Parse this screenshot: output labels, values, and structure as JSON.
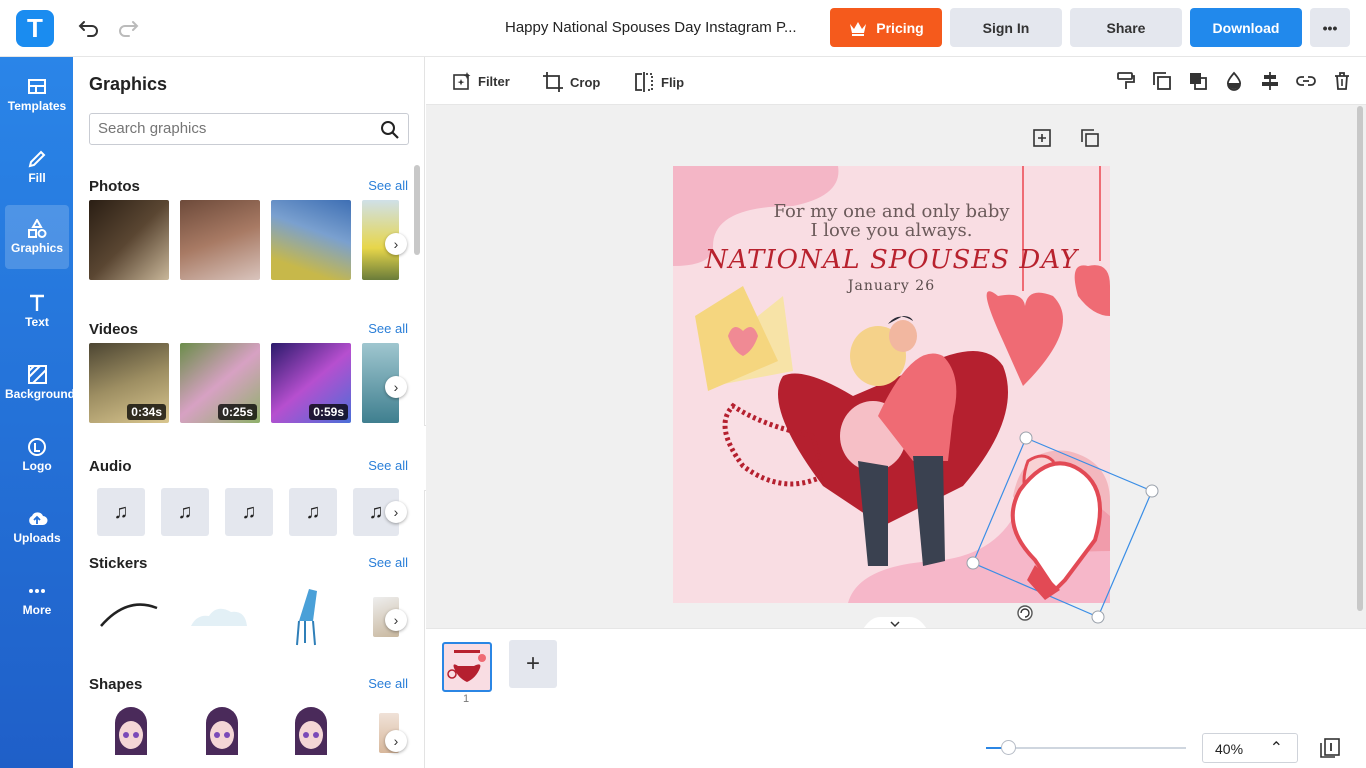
{
  "app": {
    "logo_letter": "T"
  },
  "header": {
    "document_title": "Happy National Spouses Day Instagram P...",
    "pricing_label": "Pricing",
    "signin_label": "Sign In",
    "share_label": "Share",
    "download_label": "Download",
    "more_label": "•••"
  },
  "nav": {
    "items": [
      {
        "label": "Templates",
        "icon": "templates-icon"
      },
      {
        "label": "Fill",
        "icon": "fill-icon"
      },
      {
        "label": "Graphics",
        "icon": "graphics-icon"
      },
      {
        "label": "Text",
        "icon": "text-icon"
      },
      {
        "label": "Background",
        "icon": "background-icon"
      },
      {
        "label": "Logo",
        "icon": "logo-icon"
      },
      {
        "label": "Uploads",
        "icon": "upload-icon"
      },
      {
        "label": "More",
        "icon": "more-icon"
      }
    ]
  },
  "panel": {
    "title": "Graphics",
    "search_placeholder": "Search graphics",
    "see_all": "See all",
    "sections": {
      "photos": "Photos",
      "videos": "Videos",
      "audio": "Audio",
      "stickers": "Stickers",
      "shapes": "Shapes"
    },
    "video_durations": [
      "0:34s",
      "0:25s",
      "0:59s"
    ]
  },
  "toolbar": {
    "filter_label": "Filter",
    "crop_label": "Crop",
    "flip_label": "Flip"
  },
  "canvas": {
    "line1": "For my one and only baby",
    "line2": "I love you always.",
    "headline": "NATIONAL SPOUSES DAY",
    "date": "January 26"
  },
  "pages": {
    "current": "1",
    "add_label": "+"
  },
  "zoom": {
    "value_label": "40%",
    "level_fraction": 0.11
  },
  "colors": {
    "accent": "#2189ec",
    "pricing": "#f55a1c",
    "headline": "#b8222e",
    "canvas_bg": "#f9dde3"
  }
}
